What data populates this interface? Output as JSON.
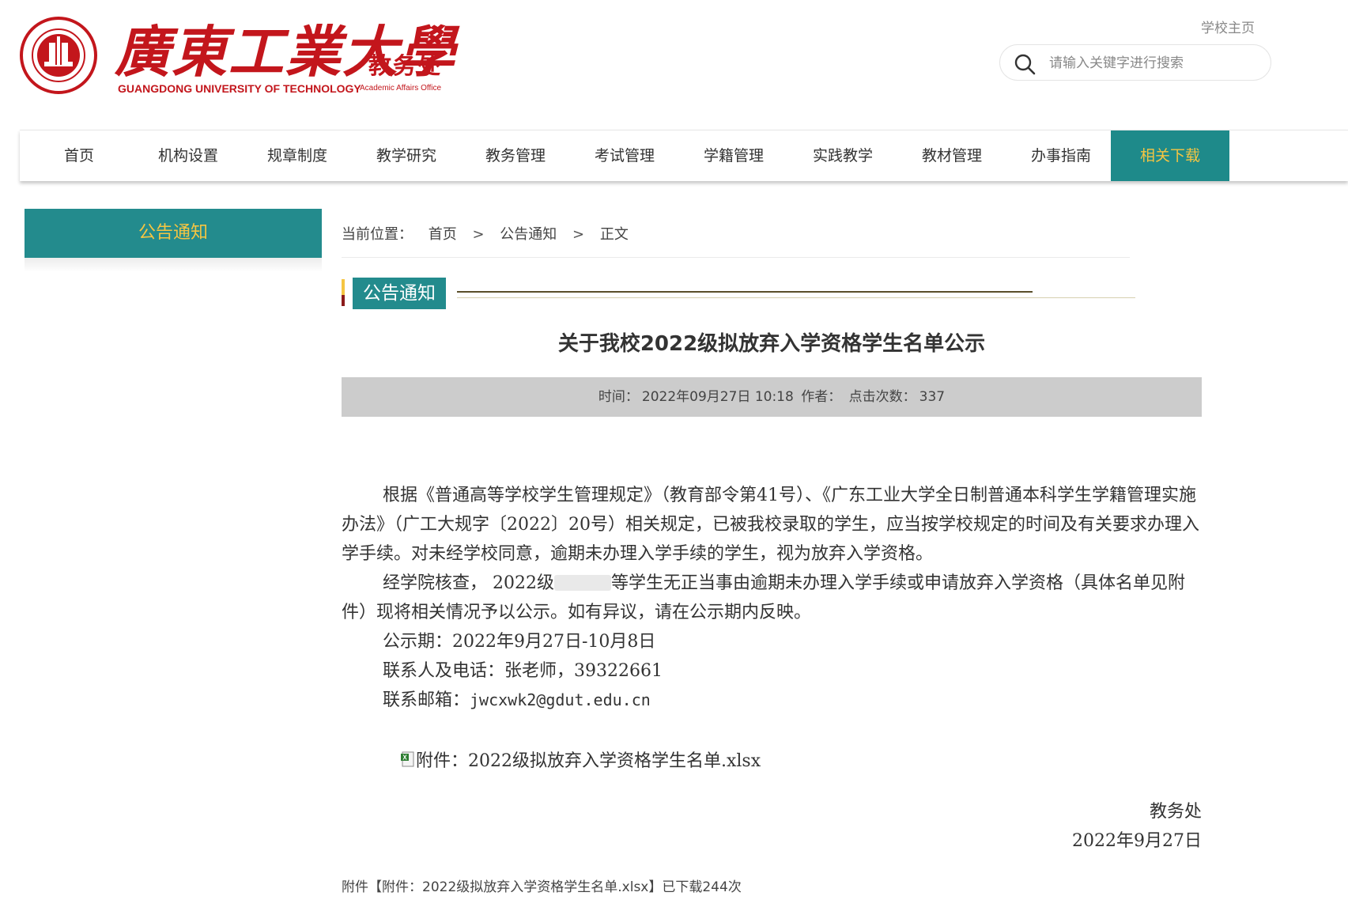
{
  "header": {
    "logo_cn": "廣東工業大學",
    "logo_en": "GUANGDONG UNIVERSITY OF TECHNOLOGY",
    "seal_text": "GUANGDONG UNIVERSITY OF TECHNOLOGY",
    "seal_footer": "廣東工業大學",
    "dept_cn": "教务处",
    "dept_en": "Academic Affairs Office",
    "home_link": "学校主页",
    "search_placeholder": "请输入关键字进行搜索"
  },
  "nav": {
    "items": [
      {
        "label": "首页"
      },
      {
        "label": "机构设置"
      },
      {
        "label": "规章制度"
      },
      {
        "label": "教学研究"
      },
      {
        "label": "教务管理"
      },
      {
        "label": "考试管理"
      },
      {
        "label": "学籍管理"
      },
      {
        "label": "实践教学"
      },
      {
        "label": "教材管理"
      },
      {
        "label": "办事指南"
      },
      {
        "label": "相关下载"
      }
    ],
    "active_label": "相关下载"
  },
  "sidebar": {
    "title": "公告通知"
  },
  "breadcrumb": {
    "prefix": "当前位置：",
    "items": [
      "首页",
      "公告通知",
      "正文"
    ],
    "separator": ">"
  },
  "section": {
    "title": "公告通知"
  },
  "article": {
    "title": "关于我校2022级拟放弃入学资格学生名单公示",
    "meta": {
      "time_label": "时间：",
      "time_value": "2022年09月27日 10:18",
      "author_label": "作者：",
      "clicks_label": "点击次数：",
      "clicks_value": "337"
    },
    "para1": "根据《普通高等学校学生管理规定》（教育部令第41号）、《广东工业大学全日制普通本科学生学籍管理实施办法》（广工大规字〔2022〕20号）相关规定，已被我校录取的学生，应当按学校规定的时间及有关要求办理入学手续。对未经学校同意，逾期未办理入学手续的学生，视为放弃入学资格。",
    "para2_before": "经学院核查， 2022级",
    "para2_after": "等学生无正当事由逾期未办理入学手续或申请放弃入学资格（具体名单见附件）现将相关情况予以公示。如有异议，请在公示期内反映。",
    "period": "公示期：2022年9月27日-10月8日",
    "contact": "联系人及电话：张老师，39322661",
    "email_label": "联系邮箱：",
    "email": "jwcxwk2@gdut.edu.cn",
    "attachment": "附件：2022级拟放弃入学资格学生名单.xlsx",
    "sign_dept": "教务处",
    "sign_date": "2022年9月27日"
  },
  "footer_note": "附件【附件：2022级拟放弃入学资格学生名单.xlsx】已下载244次",
  "colors": {
    "brand_red": "#c3161c",
    "teal": "#238b8d",
    "gold": "#f5c542",
    "meta_bg": "#cccccc"
  }
}
